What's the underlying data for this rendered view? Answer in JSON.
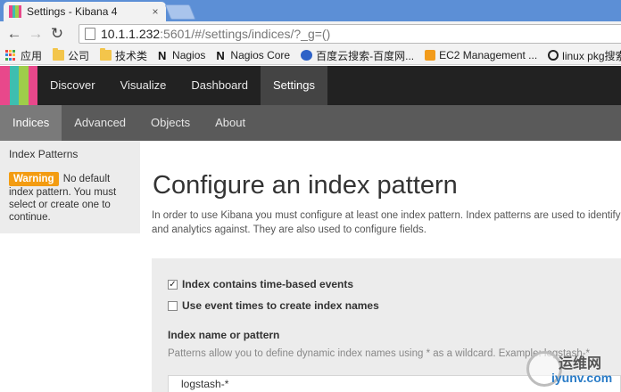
{
  "browser": {
    "tab_title": "Settings - Kibana 4",
    "tab_close": "×",
    "url_host": "10.1.1.232",
    "url_rest": ":5601/#/settings/indices/?_g=()",
    "back": "←",
    "forward": "→",
    "reload": "↻",
    "bookmarks": [
      {
        "label": "应用",
        "icon": "apps-grid-icon"
      },
      {
        "label": "公司",
        "icon": "folder-icon"
      },
      {
        "label": "技术类",
        "icon": "folder-icon"
      },
      {
        "label": "Nagios",
        "icon": "nagios-icon"
      },
      {
        "label": "Nagios Core",
        "icon": "nagios-icon"
      },
      {
        "label": "百度云搜索-百度网...",
        "icon": "baidu-icon"
      },
      {
        "label": "EC2 Management ...",
        "icon": "aws-icon"
      },
      {
        "label": "linux pkg搜索",
        "icon": "search-icon"
      }
    ]
  },
  "kibana": {
    "logo_colors": [
      "#e8488b",
      "#3ebeb0",
      "#9ecd4a",
      "#e8488b"
    ],
    "topnav": [
      {
        "label": "Discover",
        "active": false
      },
      {
        "label": "Visualize",
        "active": false
      },
      {
        "label": "Dashboard",
        "active": false
      },
      {
        "label": "Settings",
        "active": true
      }
    ],
    "subnav": [
      {
        "label": "Indices",
        "active": true
      },
      {
        "label": "Advanced",
        "active": false
      },
      {
        "label": "Objects",
        "active": false
      },
      {
        "label": "About",
        "active": false
      }
    ],
    "sidebar": {
      "title": "Index Patterns",
      "warning_badge": "Warning",
      "warning_text": "No default index pattern. You must select or create one to continue."
    },
    "main": {
      "title": "Configure an index pattern",
      "intro_line1": "In order to use Kibana you must configure at least one index pattern. Index patterns are used to identify the",
      "intro_line2": "and analytics against. They are also used to configure fields.",
      "checkbox_time": {
        "label": "Index contains time-based events",
        "checked": true,
        "mark": "✓"
      },
      "checkbox_event_times": {
        "label": "Use event times to create index names",
        "checked": false,
        "mark": ""
      },
      "field_label": "Index name or pattern",
      "field_help": "Patterns allow you to define dynamic index names using * as a wildcard. Example: logstash-*",
      "field_value": "logstash-*"
    },
    "accent_warning": "#f39c12"
  },
  "watermark": {
    "line1": "运维网",
    "line2": "iyunv.com"
  }
}
